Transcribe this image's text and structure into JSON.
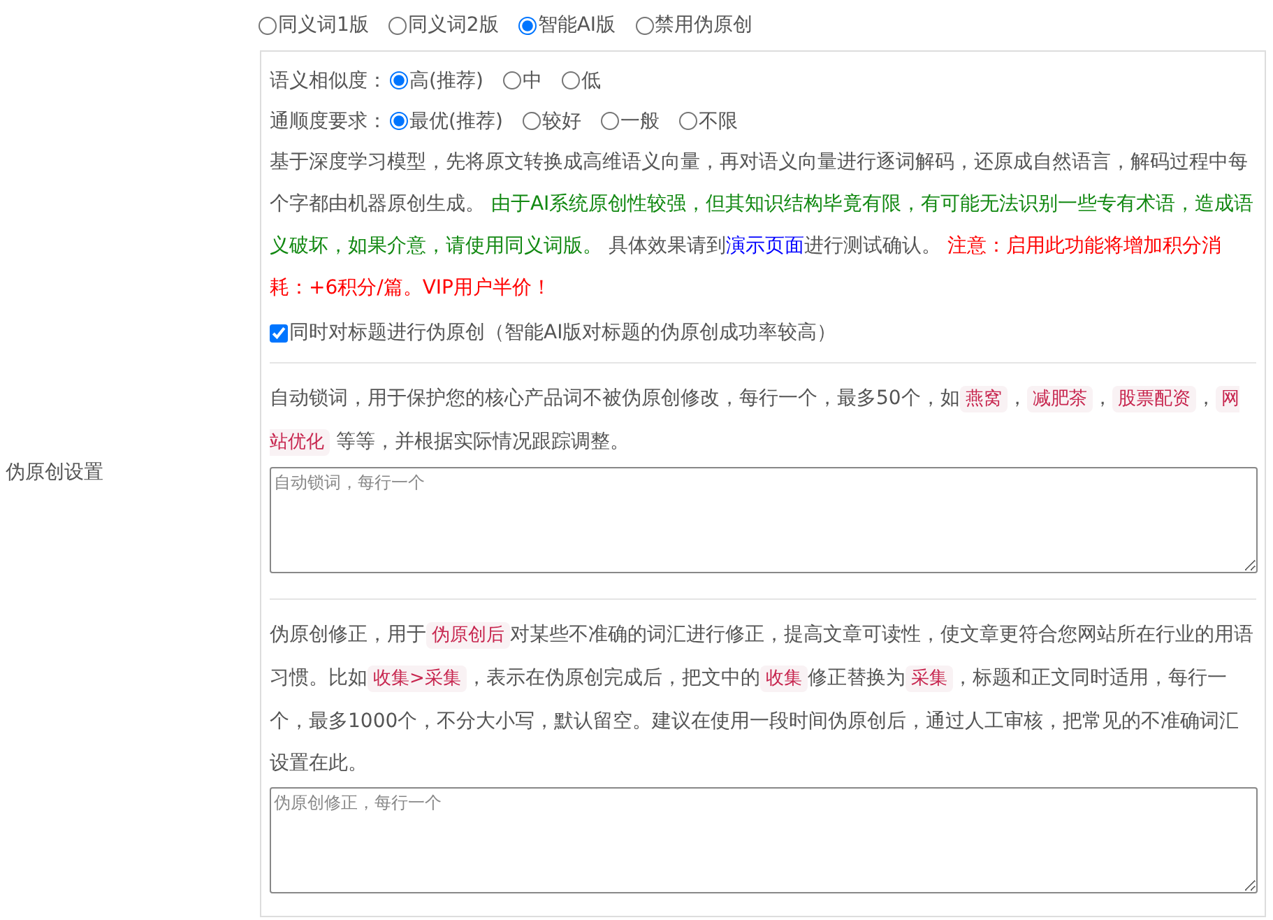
{
  "section_label": "伪原创设置",
  "modes": [
    {
      "label": "同义词1版",
      "selected": false
    },
    {
      "label": "同义词2版",
      "selected": false
    },
    {
      "label": "智能AI版",
      "selected": true
    },
    {
      "label": "禁用伪原创",
      "selected": false
    }
  ],
  "settings": [
    {
      "label": "语义相似度：",
      "options": [
        {
          "label": "高(推荐)",
          "selected": true
        },
        {
          "label": "中",
          "selected": false
        },
        {
          "label": "低",
          "selected": false
        }
      ]
    },
    {
      "label": "通顺度要求：",
      "options": [
        {
          "label": "最优(推荐)",
          "selected": true
        },
        {
          "label": "较好",
          "selected": false
        },
        {
          "label": "一般",
          "selected": false
        },
        {
          "label": "不限",
          "selected": false
        }
      ]
    }
  ],
  "ai_description": [
    {
      "kind": "plain",
      "text": "基于深度学习模型，先将原文转换成高维语义向量，再对语义向量进行逐词解码，还原成自然语言，解码过程中每个字都由机器原创生成。 "
    },
    {
      "kind": "success",
      "text": "由于AI系统原创性较强，但其知识结构毕竟有限，有可能无法识别一些专有术语，造成语义破坏，如果介意，请使用同义词版。"
    },
    {
      "kind": "plain",
      "text": " 具体效果请到"
    },
    {
      "kind": "link",
      "text": "演示页面"
    },
    {
      "kind": "plain",
      "text": "进行测试确认。 "
    },
    {
      "kind": "warning",
      "text": "注意：启用此功能将增加积分消耗：+6积分/篇。VIP用户半价！"
    }
  ],
  "title_option": {
    "label": "同时对标题进行伪原创（智能AI版对标题的伪原创成功率较高）",
    "checked": true
  },
  "lock_words": {
    "description": [
      {
        "kind": "plain",
        "text": "自动锁词，用于保护您的核心产品词不被伪原创修改，每行一个，最多50个，如"
      },
      {
        "kind": "code",
        "text": "燕窝"
      },
      {
        "kind": "plain",
        "text": "，"
      },
      {
        "kind": "code",
        "text": "减肥茶"
      },
      {
        "kind": "plain",
        "text": "，"
      },
      {
        "kind": "code",
        "text": "股票配资"
      },
      {
        "kind": "plain",
        "text": "，"
      },
      {
        "kind": "code",
        "text": "网站优化"
      },
      {
        "kind": "plain",
        "text": " 等等，并根据实际情况跟踪调整。"
      }
    ],
    "placeholder": "自动锁词，每行一个"
  },
  "corrections": {
    "description": [
      {
        "kind": "plain",
        "text": "伪原创修正，用于"
      },
      {
        "kind": "code",
        "text": "伪原创后"
      },
      {
        "kind": "plain",
        "text": "对某些不准确的词汇进行修正，提高文章可读性，使文章更符合您网站所在行业的用语习惯。比如"
      },
      {
        "kind": "code",
        "text": "收集>采集"
      },
      {
        "kind": "plain",
        "text": "，表示在伪原创完成后，把文中的"
      },
      {
        "kind": "code",
        "text": "收集"
      },
      {
        "kind": "plain",
        "text": "修正替换为"
      },
      {
        "kind": "code",
        "text": "采集"
      },
      {
        "kind": "plain",
        "text": "，标题和正文同时适用，每行一个，最多1000个，不分大小写，默认留空。建议在使用一段时间伪原创后，通过人工审核，把常见的不准确词汇设置在此。"
      }
    ],
    "placeholder": "伪原创修正，每行一个"
  }
}
